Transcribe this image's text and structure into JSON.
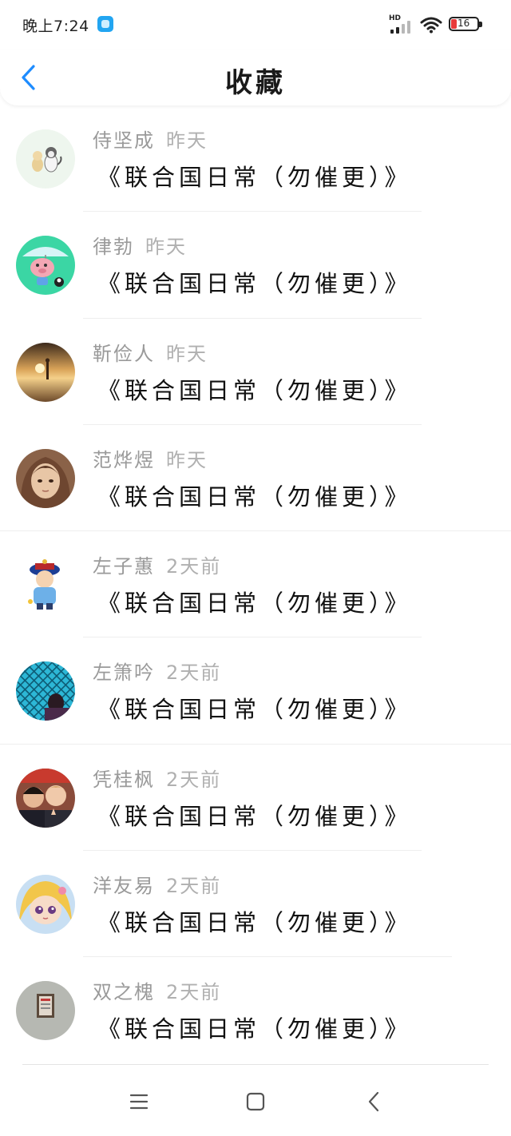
{
  "status_bar": {
    "time": "晚上7:24",
    "network": "HD",
    "battery": "16",
    "colors": {
      "battery_low": "#e83a3a",
      "app_badge": "#22a5f1"
    }
  },
  "header": {
    "back_icon": "chevron-left-icon",
    "title": "收藏",
    "accent": "#1e8cff"
  },
  "favorites": [
    {
      "name": "侍坚成",
      "time": "昨天",
      "title": "《联合国日常（勿催更）》",
      "avatar": "cartoon-cats"
    },
    {
      "name": "律勃",
      "time": "昨天",
      "title": "《联合国日常（勿催更）》",
      "avatar": "cartoon-pig-umbrella"
    },
    {
      "name": "靳俭人",
      "time": "昨天",
      "title": "《联合国日常（勿催更）》",
      "avatar": "sunset-beach"
    },
    {
      "name": "范烨煜",
      "time": "昨天",
      "title": "《联合国日常（勿催更）》",
      "avatar": "anime-girl"
    },
    {
      "name": "左子蕙",
      "time": "2天前",
      "title": "《联合国日常（勿催更）》",
      "avatar": "qing-official-cartoon"
    },
    {
      "name": "左箫吟",
      "time": "2天前",
      "title": "《联合国日常（勿催更）》",
      "avatar": "fence-girl"
    },
    {
      "name": "凭桂枫",
      "time": "2天前",
      "title": "《联合国日常（勿催更）》",
      "avatar": "two-guys-selfie"
    },
    {
      "name": "洋友易",
      "time": "2天前",
      "title": "《联合国日常（勿催更）》",
      "avatar": "chibi-blonde-girl"
    },
    {
      "name": "双之槐",
      "time": "2天前",
      "title": "《联合国日常（勿催更）》",
      "avatar": "framed-photo"
    }
  ],
  "nav_bar": {
    "icons": [
      "menu-icon",
      "home-square-icon",
      "back-triangle-icon"
    ]
  }
}
